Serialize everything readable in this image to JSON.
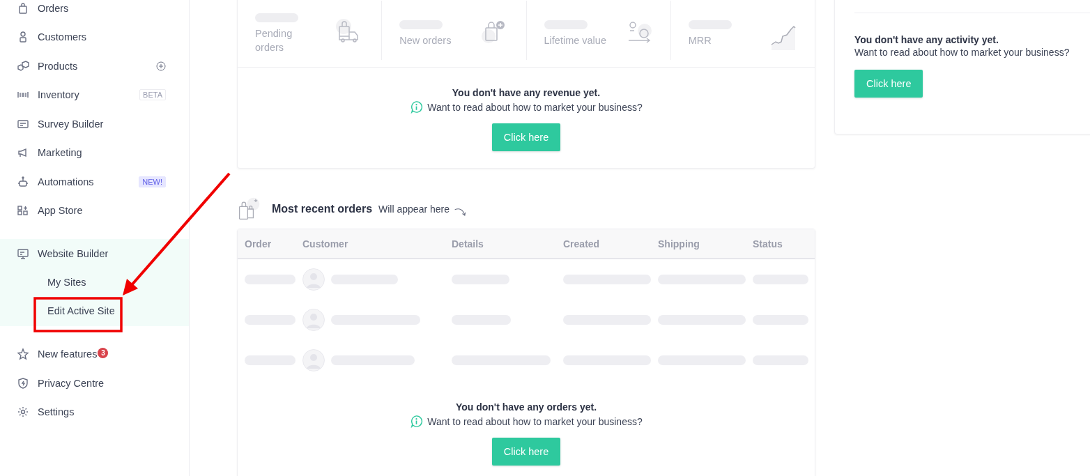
{
  "sidebar": {
    "items": [
      {
        "label": "Orders",
        "expanded": false,
        "add_button": false
      },
      {
        "label": "Customers",
        "expanded": false,
        "add_button": false
      },
      {
        "label": "Products",
        "expanded": false,
        "add_button": true
      },
      {
        "label": "Inventory",
        "expanded": false,
        "add_button": false,
        "badge": {
          "text": "BETA",
          "kind": "tag"
        }
      },
      {
        "label": "Survey Builder",
        "expanded": false,
        "add_button": false
      },
      {
        "label": "Marketing",
        "expanded": false,
        "add_button": false
      },
      {
        "label": "Automations",
        "expanded": false,
        "add_button": false,
        "badge": {
          "text": "NEW!",
          "kind": "new"
        }
      },
      {
        "label": "App Store",
        "expanded": false,
        "add_button": false
      },
      {
        "label": "Website Builder",
        "expanded": true,
        "add_button": false,
        "children": [
          {
            "label": "My Sites"
          },
          {
            "label": "Edit Active Site"
          }
        ]
      },
      {
        "label": "New features",
        "expanded": false,
        "add_button": false,
        "badge": {
          "text": "3",
          "kind": "count"
        }
      },
      {
        "label": "Privacy Centre",
        "expanded": false,
        "add_button": false
      },
      {
        "label": "Settings",
        "expanded": false,
        "add_button": false
      }
    ]
  },
  "stats": [
    {
      "label": "Pending orders"
    },
    {
      "label": "New orders"
    },
    {
      "label": "Lifetime value"
    },
    {
      "label": "MRR"
    }
  ],
  "revenue_empty": {
    "title": "You don't have any revenue yet.",
    "text": "Want to read about how to market your business?",
    "button": "Click here"
  },
  "recent_orders": {
    "title": "Most recent orders",
    "subtitle": "Will appear here",
    "columns": [
      "Order",
      "Customer",
      "Details",
      "Created",
      "Shipping",
      "Status"
    ],
    "empty": {
      "title": "You don't have any orders yet.",
      "text": "Want to read about how to market your business?",
      "button": "Click here"
    }
  },
  "activity_empty": {
    "title": "You don't have any activity yet.",
    "text": "Want to read about how to market your business?",
    "button": "Click here"
  }
}
